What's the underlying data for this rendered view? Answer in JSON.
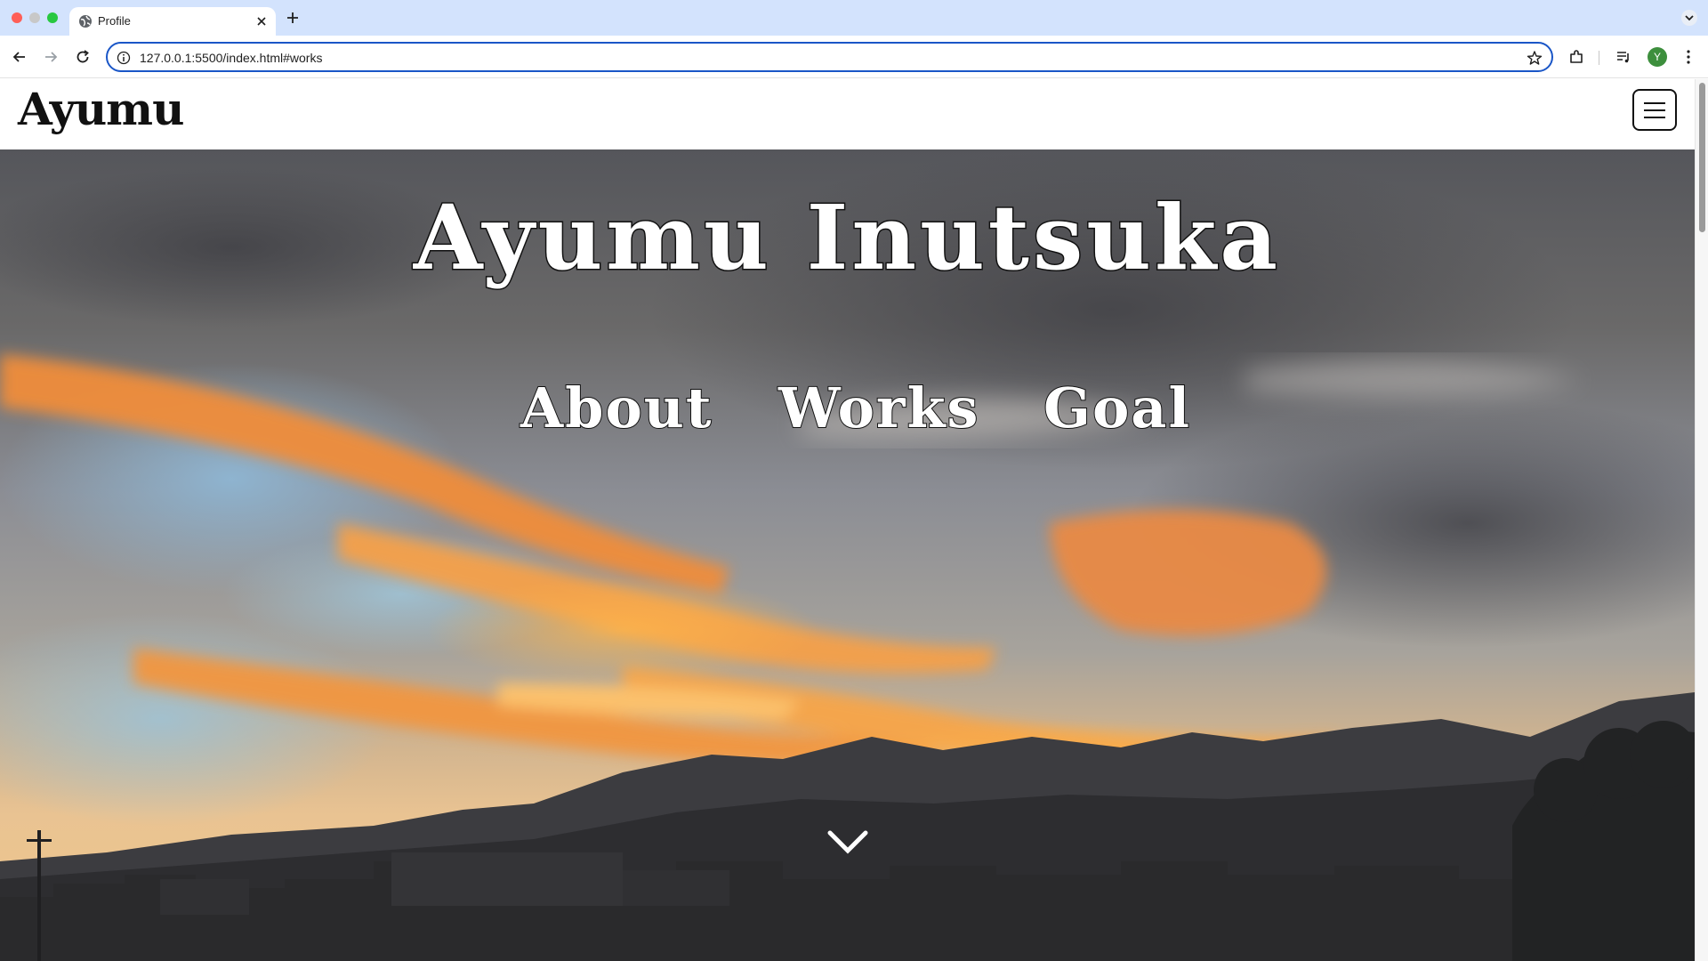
{
  "browser": {
    "tab_title": "Profile",
    "url": "127.0.0.1:5500/index.html#works",
    "profile_initial": "Y"
  },
  "site": {
    "logo": "Ayumu",
    "hero_title": "Ayumu Inutsuka",
    "nav": [
      "About",
      "Works",
      "Goal"
    ]
  },
  "colors": {
    "accent": "#1a56c7",
    "tabbar": "#d3e3fd",
    "text_outline": "#111111",
    "sky_orange": "#f59a3a",
    "sky_blue": "#8fb6d3"
  },
  "icons": {
    "scroll_down": "chevron-down-icon",
    "menu": "hamburger-icon"
  }
}
